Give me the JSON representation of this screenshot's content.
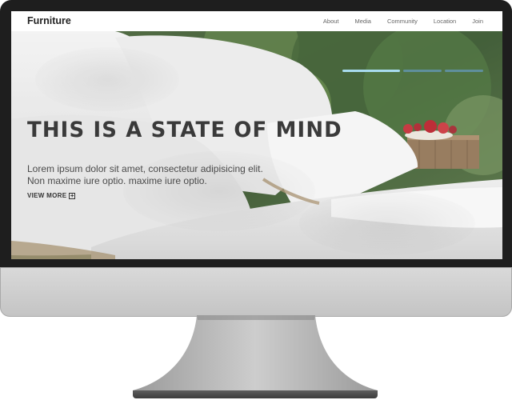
{
  "nav": {
    "brand": "Furniture",
    "links": [
      "About",
      "Media",
      "Community",
      "Location",
      "Join"
    ]
  },
  "hero": {
    "headline": "THIS IS A STATE OF MIND",
    "body_line1": "Lorem ipsum dolor sit amet, consectetur adipisicing elit.",
    "body_line2": "Non maxime iure optio. maxime iure optio.",
    "cta_label": "VIEW MORE",
    "cta_icon": "plus-icon",
    "slider_count": 3,
    "slider_active": 1
  },
  "colors": {
    "slider_active": "#a8dcef",
    "slider_inactive": "#5f8f9c",
    "headline": "#3a3a3a",
    "monitor_bezel": "#1e1e1e",
    "monitor_chin": "#d0d0d0"
  }
}
